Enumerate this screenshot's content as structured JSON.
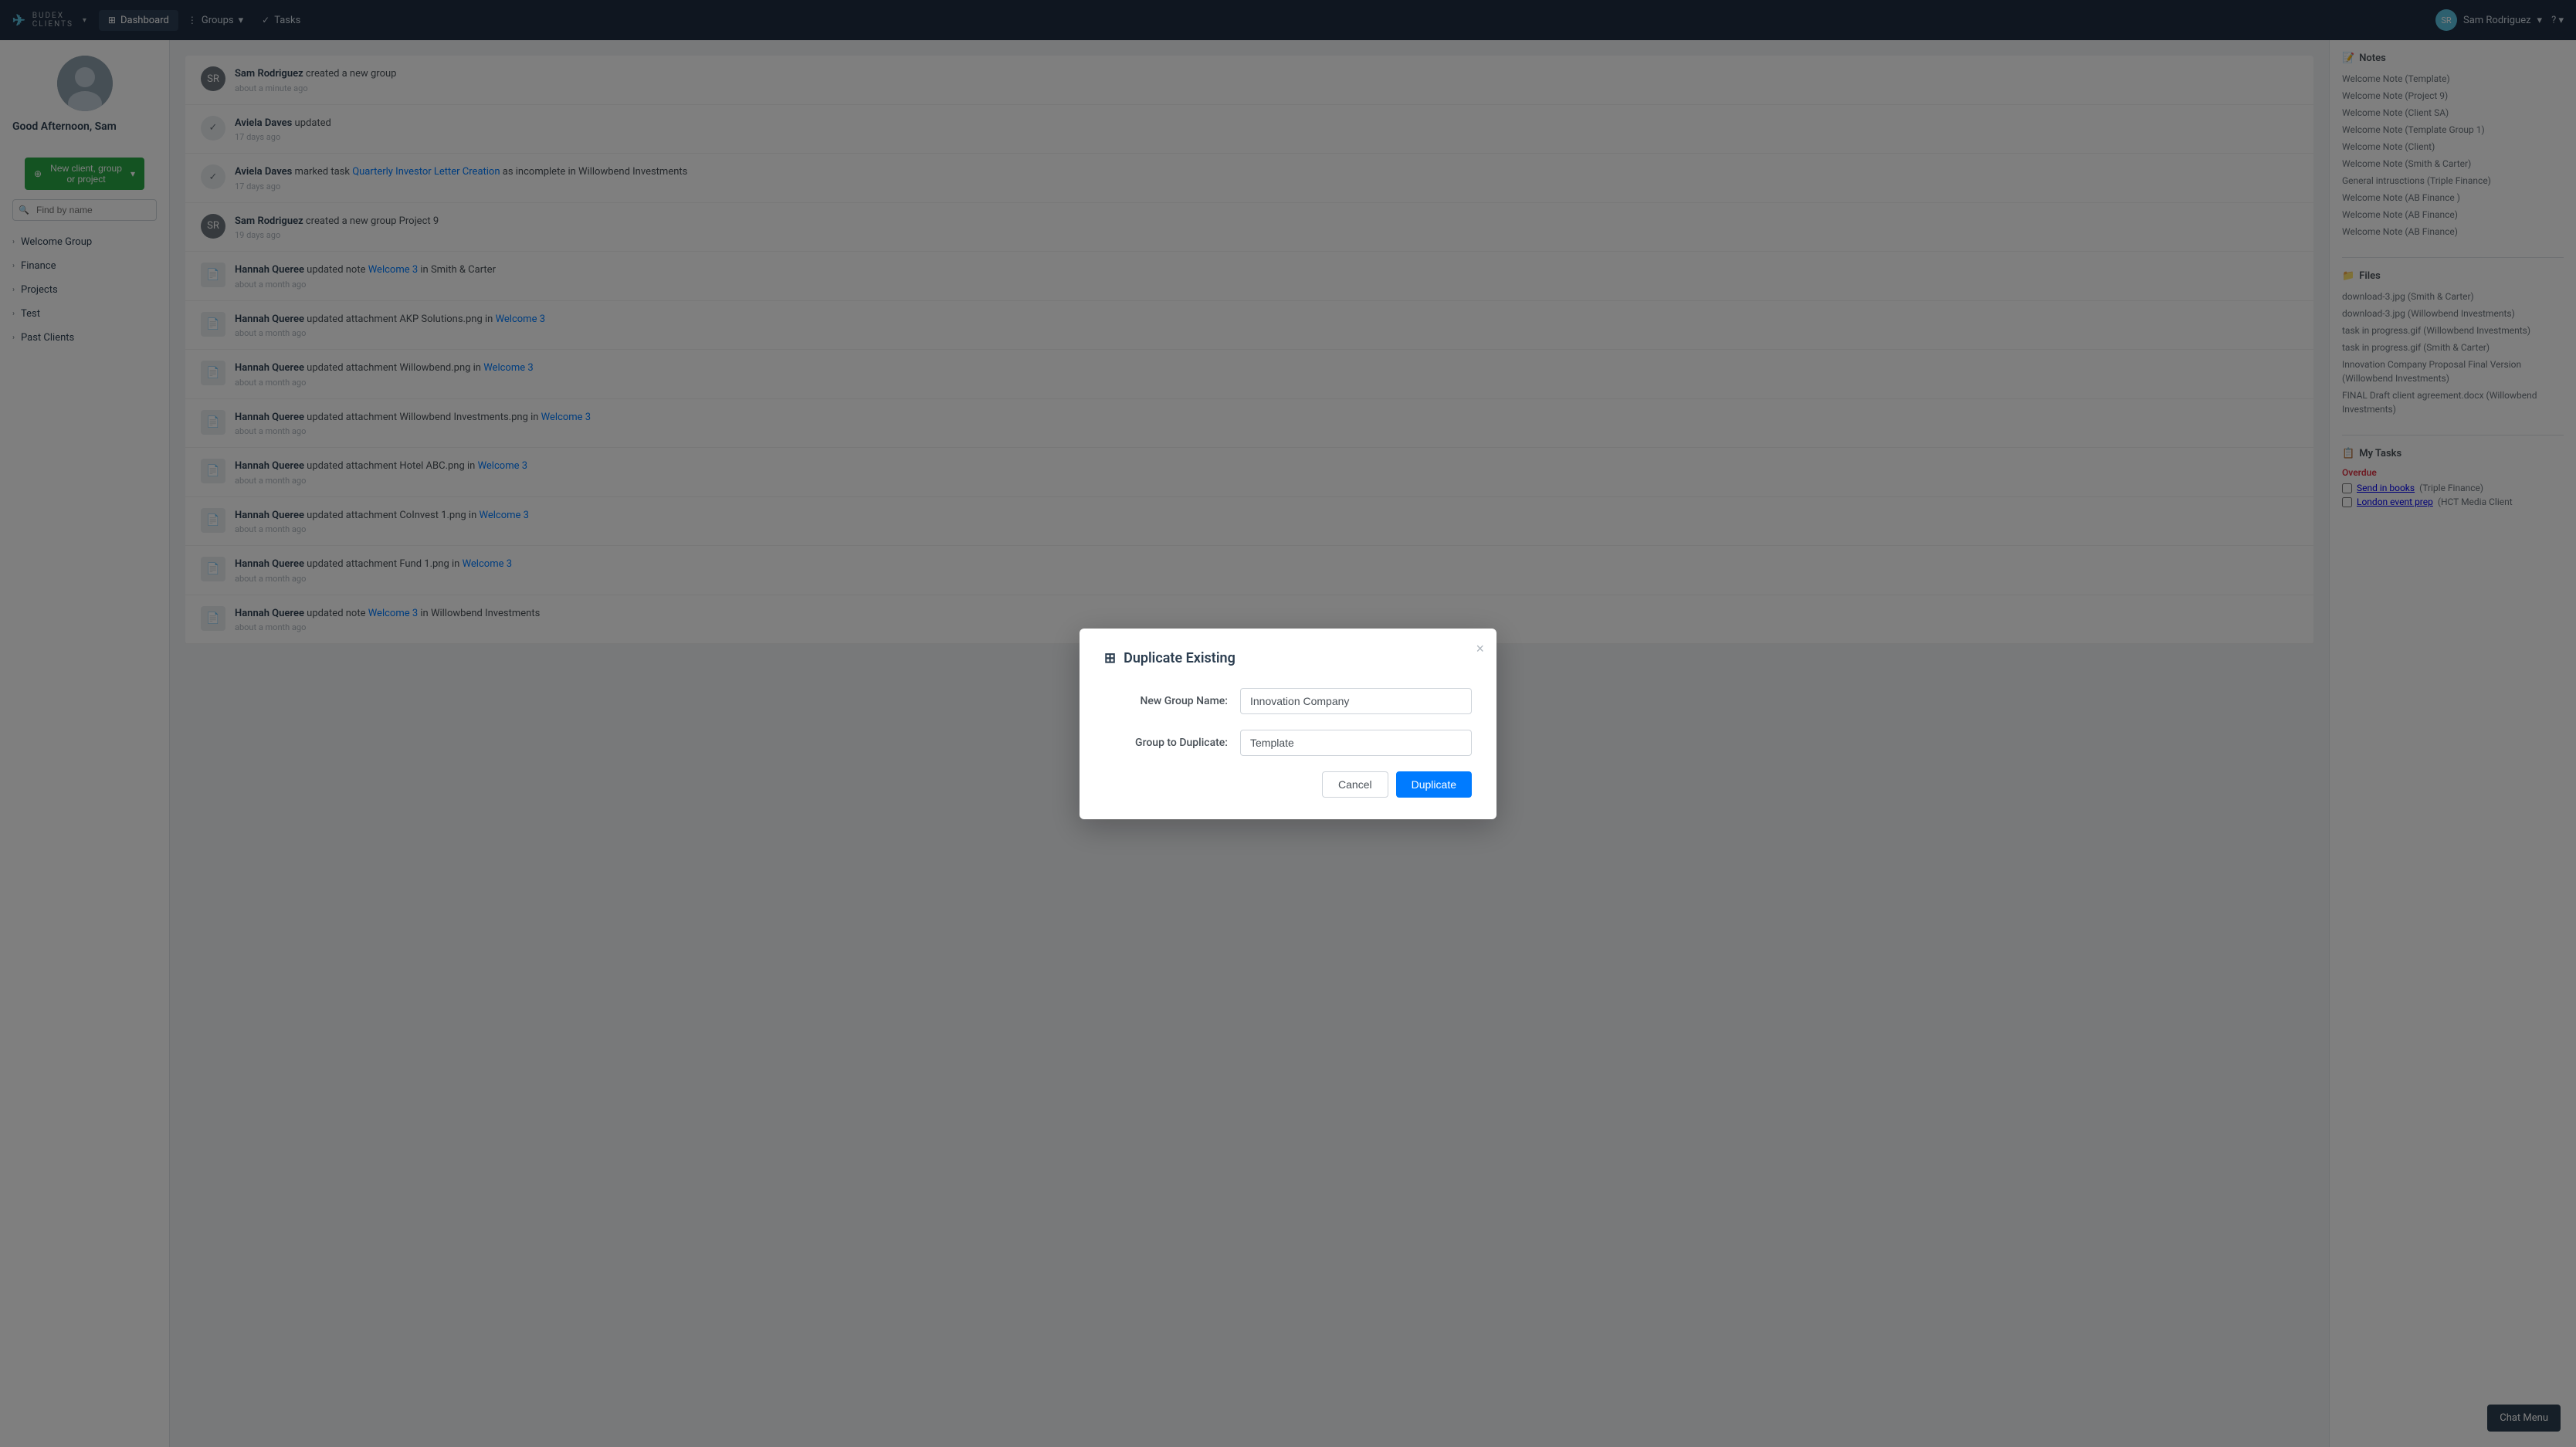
{
  "app": {
    "name": "BUDEX",
    "subtitle": "CLIENTS"
  },
  "nav": {
    "dropdown_arrow": "▾",
    "items": [
      {
        "label": "Dashboard",
        "icon": "⊞",
        "active": true
      },
      {
        "label": "Groups",
        "icon": "⋮⊞",
        "has_dropdown": true
      },
      {
        "label": "Tasks",
        "icon": "✓",
        "has_dropdown": false
      }
    ],
    "user": {
      "name": "Sam Rodriguez",
      "dropdown": true
    },
    "help_label": "?"
  },
  "sidebar": {
    "greeting": "Good Afternoon, Sam",
    "new_client_btn": "New client, group or project",
    "search_placeholder": "Find by name",
    "items": [
      {
        "label": "Welcome Group"
      },
      {
        "label": "Finance"
      },
      {
        "label": "Projects"
      },
      {
        "label": "Test"
      },
      {
        "label": "Past Clients"
      }
    ]
  },
  "activity": [
    {
      "type": "person",
      "text_before": "",
      "actor": "Sam Rodriguez",
      "action": "create",
      "text_after": "d a new group",
      "link_text": "",
      "time": "about a minute ago"
    },
    {
      "type": "check",
      "actor": "Aviela Daves",
      "action": "updated",
      "text_after": "",
      "link_text": "",
      "time": "17 days ago"
    },
    {
      "type": "check",
      "actor": "Aviela Daves",
      "action": "marked task",
      "link_text": "Quarterly Investor Letter Creation",
      "text_after": "as incomplete in Willowbend Investments",
      "time": "17 days ago"
    },
    {
      "type": "person",
      "actor": "Sam Rodriguez",
      "action": "created a new group",
      "link_text": "Project 9",
      "text_after": "",
      "time": "19 days ago"
    },
    {
      "type": "file",
      "actor": "Hannah Queree",
      "action": "updated note",
      "link_text": "Welcome 3",
      "text_after": "in Smith & Carter",
      "time": "about a month ago"
    },
    {
      "type": "file",
      "actor": "Hannah Queree",
      "action": "updated attachment AKP Solutions.png in",
      "link_text": "Welcome 3",
      "text_after": "",
      "time": "about a month ago"
    },
    {
      "type": "file",
      "actor": "Hannah Queree",
      "action": "updated attachment Willowbend.png in",
      "link_text": "Welcome 3",
      "text_after": "",
      "time": "about a month ago"
    },
    {
      "type": "file",
      "actor": "Hannah Queree",
      "action": "updated attachment Willowbend Investments.png in",
      "link_text": "Welcome 3",
      "text_after": "",
      "time": "about a month ago"
    },
    {
      "type": "file",
      "actor": "Hannah Queree",
      "action": "updated attachment Hotel ABC.png in",
      "link_text": "Welcome 3",
      "text_after": "",
      "time": "about a month ago"
    },
    {
      "type": "file",
      "actor": "Hannah Queree",
      "action": "updated attachment CoInvest 1.png in",
      "link_text": "Welcome 3",
      "text_after": "",
      "time": "about a month ago"
    },
    {
      "type": "file",
      "actor": "Hannah Queree",
      "action": "updated attachment Fund 1.png in",
      "link_text": "Welcome 3",
      "text_after": "",
      "time": "about a month ago"
    },
    {
      "type": "file",
      "actor": "Hannah Queree",
      "action": "updated note",
      "link_text": "Welcome 3",
      "text_after": "in Willowbend Investments",
      "time": "about a month ago"
    }
  ],
  "right_panel": {
    "notes_title": "Notes",
    "notes_icon": "📝",
    "notes": [
      {
        "label": "Welcome Note",
        "context": "(Template)"
      },
      {
        "label": "Welcome Note",
        "context": "(Project 9)"
      },
      {
        "label": "Welcome Note",
        "context": "(Client SA)"
      },
      {
        "label": "Welcome Note",
        "context": "(Template Group 1)"
      },
      {
        "label": "Welcome Note",
        "context": "(Client)"
      },
      {
        "label": "Welcome Note",
        "context": "(Smith & Carter)"
      },
      {
        "label": "General intrusctions",
        "context": "(Triple Finance)"
      },
      {
        "label": "Welcome Note",
        "context": "(AB Finance )"
      },
      {
        "label": "Welcome Note",
        "context": "(AB Finance)"
      },
      {
        "label": "Welcome Note",
        "context": "(AB Finance)"
      }
    ],
    "files_title": "Files",
    "files_icon": "📁",
    "files": [
      {
        "label": "download-3.jpg",
        "context": "(Smith & Carter)"
      },
      {
        "label": "download-3.jpg",
        "context": "(Willowbend Investments)"
      },
      {
        "label": "task in progress.gif",
        "context": "(Willowbend Investments)"
      },
      {
        "label": "task in progress.gif",
        "context": "(Smith & Carter)"
      },
      {
        "label": "Innovation Company Proposal Final Version",
        "context": "(Willowbend Investments)"
      },
      {
        "label": "FINAL Draft client agreement.docx",
        "context": "(Willowbend Investments)"
      }
    ],
    "tasks_title": "My Tasks",
    "tasks_icon": "📋",
    "overdue_label": "Overdue",
    "tasks": [
      {
        "label": "Send in books",
        "context": "(Triple Finance)"
      },
      {
        "label": "London event prep",
        "context": "(HCT Media Client"
      }
    ]
  },
  "modal": {
    "title": "Duplicate Existing",
    "title_icon": "⊞",
    "close_icon": "×",
    "new_group_name_label": "New Group Name:",
    "new_group_name_value": "Innovation Company",
    "group_to_duplicate_label": "Group to Duplicate:",
    "group_to_duplicate_value": "Template",
    "cancel_btn": "Cancel",
    "duplicate_btn": "Duplicate"
  },
  "chat_menu_btn": "Chat Menu"
}
